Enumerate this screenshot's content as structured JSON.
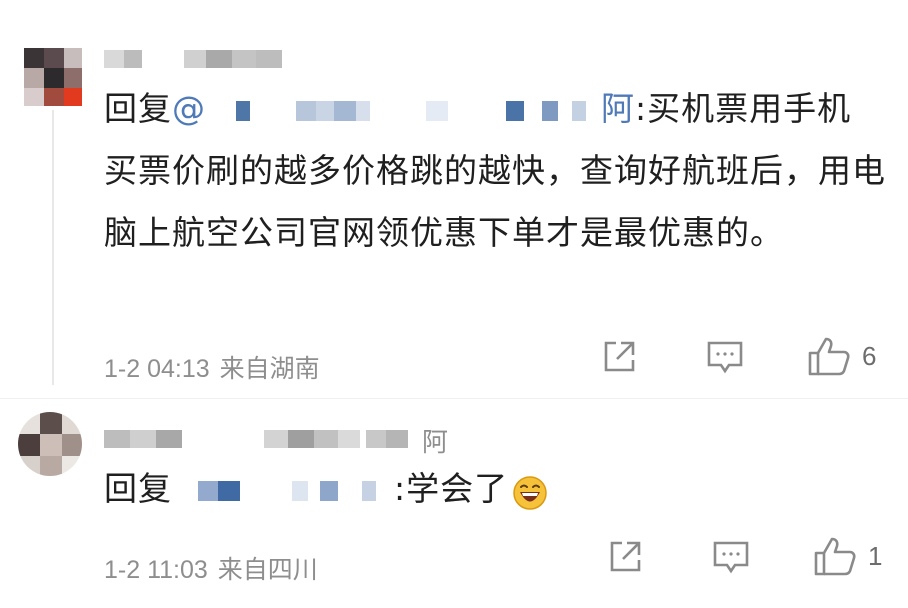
{
  "comments": [
    {
      "reply_prefix": "回复",
      "mention_prefix": "@",
      "mention_tail": "阿",
      "text_line1": ":买机票用手机",
      "text_rest": "买票价刷的越多价格跳的越快，查询好航班后，用电脑上航空公司官网领优惠下单才是最优惠的。",
      "date": "1-2 04:13",
      "location": "来自湖南",
      "like_count": "6",
      "icons": [
        "share-icon",
        "comment-icon",
        "like-icon"
      ]
    },
    {
      "username_tail": "阿",
      "reply_prefix": "回复",
      "text": ":学会了",
      "emoji": "laughing-emoji",
      "date": "1-2 11:03",
      "location": "来自四川",
      "like_count": "1",
      "icons": [
        "share-icon",
        "comment-icon",
        "like-icon"
      ]
    }
  ]
}
